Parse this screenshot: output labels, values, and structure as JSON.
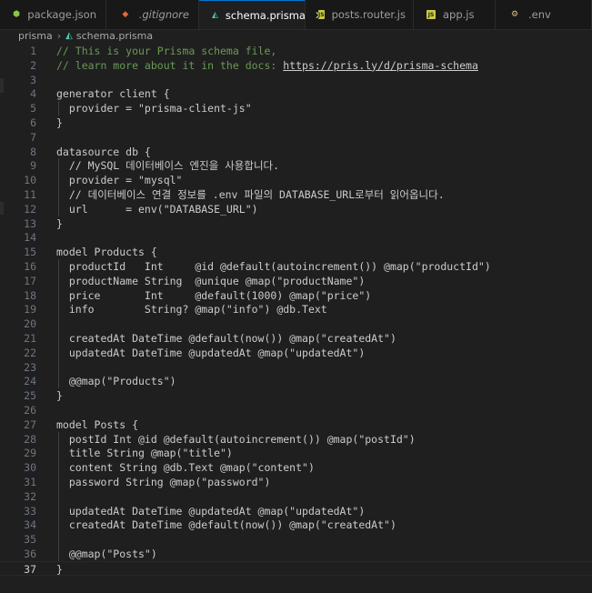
{
  "tabs": [
    {
      "label": "package.json",
      "icon": "node-icon",
      "glyph": "⬢",
      "active": false,
      "italic": false
    },
    {
      "label": ".gitignore",
      "icon": "git-icon",
      "glyph": "◆",
      "active": false,
      "italic": true
    },
    {
      "label": "schema.prisma",
      "icon": "prisma-icon",
      "glyph": "◭",
      "active": true,
      "italic": false
    },
    {
      "label": "posts.router.js",
      "icon": "js-icon",
      "glyph": "JS",
      "active": false,
      "italic": false
    },
    {
      "label": "app.js",
      "icon": "js-icon",
      "glyph": "JS",
      "active": false,
      "italic": false
    },
    {
      "label": ".env",
      "icon": "env-icon",
      "glyph": "⚙",
      "active": false,
      "italic": false
    }
  ],
  "close_glyph": "✕",
  "breadcrumb": {
    "folder": "prisma",
    "separator": "›",
    "file": "schema.prisma"
  },
  "current_line": 37,
  "lines": [
    {
      "n": "1",
      "text": "// This is your Prisma schema file,",
      "type": "comment"
    },
    {
      "n": "2",
      "text": "// learn more about it in the docs: ",
      "type": "comment",
      "link": "https://pris.ly/d/prisma-schema"
    },
    {
      "n": "3",
      "text": "",
      "type": "plain"
    },
    {
      "n": "4",
      "text": "generator client {",
      "type": "plain"
    },
    {
      "n": "5",
      "text": "  provider = \"prisma-client-js\"",
      "type": "plain"
    },
    {
      "n": "6",
      "text": "}",
      "type": "plain"
    },
    {
      "n": "7",
      "text": "",
      "type": "plain"
    },
    {
      "n": "8",
      "text": "datasource db {",
      "type": "plain"
    },
    {
      "n": "9",
      "text": "  // MySQL 데이터베이스 엔진을 사용합니다.",
      "type": "plain"
    },
    {
      "n": "10",
      "text": "  provider = \"mysql\"",
      "type": "plain"
    },
    {
      "n": "11",
      "text": "  // 데이터베이스 연결 정보를 .env 파일의 DATABASE_URL로부터 읽어옵니다.",
      "type": "plain"
    },
    {
      "n": "12",
      "text": "  url      = env(\"DATABASE_URL\")",
      "type": "plain"
    },
    {
      "n": "13",
      "text": "}",
      "type": "plain"
    },
    {
      "n": "14",
      "text": "",
      "type": "plain"
    },
    {
      "n": "15",
      "text": "model Products {",
      "type": "plain"
    },
    {
      "n": "16",
      "text": "  productId   Int     @id @default(autoincrement()) @map(\"productId\")",
      "type": "plain"
    },
    {
      "n": "17",
      "text": "  productName String  @unique @map(\"productName\")",
      "type": "plain"
    },
    {
      "n": "18",
      "text": "  price       Int     @default(1000) @map(\"price\")",
      "type": "plain"
    },
    {
      "n": "19",
      "text": "  info        String? @map(\"info\") @db.Text",
      "type": "plain"
    },
    {
      "n": "20",
      "text": "",
      "type": "plain"
    },
    {
      "n": "21",
      "text": "  createdAt DateTime @default(now()) @map(\"createdAt\")",
      "type": "plain"
    },
    {
      "n": "22",
      "text": "  updatedAt DateTime @updatedAt @map(\"updatedAt\")",
      "type": "plain"
    },
    {
      "n": "23",
      "text": "",
      "type": "plain"
    },
    {
      "n": "24",
      "text": "  @@map(\"Products\")",
      "type": "plain"
    },
    {
      "n": "25",
      "text": "}",
      "type": "plain"
    },
    {
      "n": "26",
      "text": "",
      "type": "plain"
    },
    {
      "n": "27",
      "text": "model Posts {",
      "type": "plain"
    },
    {
      "n": "28",
      "text": "  postId Int @id @default(autoincrement()) @map(\"postId\")",
      "type": "plain"
    },
    {
      "n": "29",
      "text": "  title String @map(\"title\")",
      "type": "plain"
    },
    {
      "n": "30",
      "text": "  content String @db.Text @map(\"content\")",
      "type": "plain"
    },
    {
      "n": "31",
      "text": "  password String @map(\"password\")",
      "type": "plain"
    },
    {
      "n": "32",
      "text": "",
      "type": "plain"
    },
    {
      "n": "33",
      "text": "  updatedAt DateTime @updatedAt @map(\"updatedAt\")",
      "type": "plain"
    },
    {
      "n": "34",
      "text": "  createdAt DateTime @default(now()) @map(\"createdAt\")",
      "type": "plain"
    },
    {
      "n": "35",
      "text": "",
      "type": "plain"
    },
    {
      "n": "36",
      "text": "  @@map(\"Posts\")",
      "type": "plain"
    },
    {
      "n": "37",
      "text": "}",
      "type": "plain"
    }
  ],
  "colors": {
    "background": "#1f1f1f",
    "tab_active_border": "#0078d4",
    "comment": "#6a9955",
    "text": "#cccccc",
    "line_number": "#6e7681"
  }
}
